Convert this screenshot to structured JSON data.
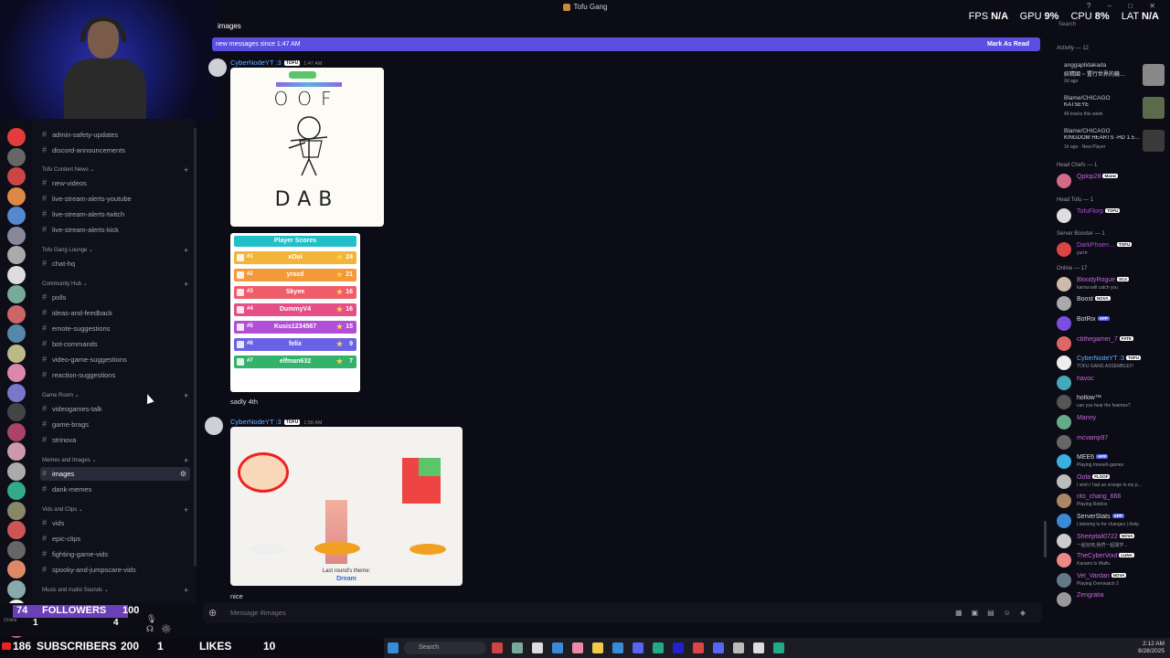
{
  "window": {
    "title": "Tofu Gang",
    "controls": [
      "?",
      "–",
      "□",
      "✕"
    ]
  },
  "overlay": {
    "fps_label": "FPS",
    "fps": "N/A",
    "gpu_label": "GPU",
    "gpu": "9%",
    "cpu_label": "CPU",
    "cpu": "8%",
    "lat_label": "LAT",
    "lat": "N/A"
  },
  "header": {
    "channel": "images",
    "search_placeholder": "Search"
  },
  "new_messages": {
    "text": "new messages since 1:47 AM",
    "mark_read": "Mark As Read"
  },
  "sidebar": {
    "categories": [
      {
        "label": "Tofu Content News ⌄",
        "channels": [
          "new-videos",
          "live-stream-alerts-youtube",
          "live-stream-alerts-twitch",
          "live-stream-alerts-kick"
        ]
      },
      {
        "label": "Tofu Gang Lounge ⌄",
        "channels": [
          "chat-hq"
        ]
      },
      {
        "label": "Community Hub ⌄",
        "channels": [
          "polls",
          "ideas-and-feedback",
          "emote-suggestions",
          "bot-commands",
          "video-game-suggestions",
          "reaction-suggestions"
        ]
      },
      {
        "label": "Game Room ⌄",
        "channels": [
          "videogames-talk",
          "game-brags",
          "strinova"
        ]
      },
      {
        "label": "Memes and Images ⌄",
        "channels": [
          "images",
          "dank-memes"
        ]
      },
      {
        "label": "Vids and Clips ⌄",
        "channels": [
          "vids",
          "epic-clips",
          "fighting-game-vids",
          "spooky-and-jumpscare-vids"
        ]
      },
      {
        "label": "Music and Audio Sounds ⌄",
        "channels": []
      }
    ],
    "top_channels": [
      "admin-safety-updates",
      "discord-announcements"
    ]
  },
  "stream": {
    "followers_count": "74",
    "followers_label": "FOLLOWERS",
    "followers_goal": "100",
    "sub_count": "186",
    "sub_label": "SUBSCRIBERS",
    "sub_goal": "200",
    "likes_count": "1",
    "likes_label": "LIKES",
    "likes_goal": "10",
    "user_status": "Online",
    "user_count_a": "1",
    "user_count_b": "4"
  },
  "messages": [
    {
      "author": "CyberNodeYT :3",
      "tag": "TOFU",
      "time": "1:47 AM",
      "drawing_words": [
        "OOF",
        "DAB"
      ],
      "scores_title": "Player Scores",
      "scores": [
        {
          "rank": "#1",
          "name": "xOui",
          "points": "24",
          "color": "#f2b53a"
        },
        {
          "rank": "#2",
          "name": "yraxd",
          "points": "21",
          "color": "#f29a3a"
        },
        {
          "rank": "#3",
          "name": "Skyee",
          "points": "16",
          "color": "#ef5d6a"
        },
        {
          "rank": "#4",
          "name": "DummyV4",
          "points": "16",
          "color": "#e64f86"
        },
        {
          "rank": "#5",
          "name": "Kusis1234567",
          "points": "15",
          "color": "#b04fd6"
        },
        {
          "rank": "#6",
          "name": "felix",
          "points": "9",
          "color": "#6a62e4"
        },
        {
          "rank": "#7",
          "name": "elfman632",
          "points": "7",
          "color": "#33b36a"
        }
      ],
      "text": "sadly 4th"
    },
    {
      "author": "CyberNodeYT :3",
      "tag": "TOFU",
      "time": "1:58 AM",
      "theme_label": "Last round's theme:",
      "theme": "Dream",
      "text": "nice"
    }
  ],
  "compose": {
    "placeholder": "Message #images"
  },
  "members": {
    "activity_head": "Activity — 12",
    "activities": [
      {
        "name": "anggaptidakada",
        "line": "妖精國 ~ 置行世界的鏡…",
        "sub": "2d ago",
        "color": "#888"
      },
      {
        "name": "Blame/CHICAGO",
        "line": "KATSEYE",
        "sub": "49 tracks this week",
        "color": "#5a6a4a"
      },
      {
        "name": "Blame/CHICAGO",
        "line": "KINGDOM HEARTS -HD 1.5…",
        "sub": "1h ago · New Player",
        "color": "#3a3a3a"
      }
    ],
    "groups": [
      {
        "head": "Head Chefs — 1",
        "items": [
          {
            "name": "Qplop28",
            "badge": "Maow",
            "sub": "",
            "color": "#c46ad6",
            "av": "#d46a8a"
          }
        ]
      },
      {
        "head": "Head Tofu — 1",
        "items": [
          {
            "name": "TofuFlorp",
            "badge": "TOFU",
            "sub": "",
            "color": "#b04fd6",
            "av": "#ddd"
          }
        ]
      },
      {
        "head": "Server Booster — 1",
        "items": [
          {
            "name": "DarkPhoen…",
            "badge": "TOFU",
            "sub": "yurrrr",
            "color": "#b04fd6",
            "av": "#d44"
          }
        ]
      },
      {
        "head": "Online — 17",
        "items": [
          {
            "name": "BloodyRogue",
            "badge": "SC4",
            "sub": "karma will catch you",
            "color": "#c46ad6",
            "av": "#cba"
          },
          {
            "name": "Boost",
            "badge": "NOVA",
            "sub": "",
            "color": "#ddd",
            "av": "#aaa"
          },
          {
            "name": "BotRix",
            "badge": "APP",
            "sub": "",
            "color": "#ddd",
            "av": "#7a4fe0"
          },
          {
            "name": "cbthegamer_7",
            "badge": "FATE",
            "sub": "",
            "color": "#c46ad6",
            "av": "#d66"
          },
          {
            "name": "CyberNodeYT :3",
            "badge": "TOFU",
            "sub": "TOFU GANG ASSEMBLE!!!",
            "color": "#5fb0ff",
            "av": "#eee"
          },
          {
            "name": "havoc",
            "badge": "",
            "sub": "",
            "color": "#c46ad6",
            "av": "#4ab"
          },
          {
            "name": "hollow™",
            "badge": "",
            "sub": "can you hear the fwames?",
            "color": "#ddd",
            "av": "#555"
          },
          {
            "name": "Manny",
            "badge": "",
            "sub": "",
            "color": "#c46ad6",
            "av": "#6a8"
          },
          {
            "name": "mcvamp97",
            "badge": "",
            "sub": "",
            "color": "#c46ad6",
            "av": "#666"
          },
          {
            "name": "MEE6",
            "badge": "APP",
            "sub": "Playing /meee6-games",
            "color": "#ddd",
            "av": "#3ab0e0"
          },
          {
            "name": "Oofa",
            "badge": "FLOOF",
            "sub": "I wish I had an orange in my p…",
            "color": "#c46ad6",
            "av": "#bbb"
          },
          {
            "name": "rito_chang_666",
            "badge": "",
            "sub": "Playing Roblox",
            "color": "#c46ad6",
            "av": "#a86"
          },
          {
            "name": "ServerStats",
            "badge": "APP",
            "sub": "Listening to for changes | /help",
            "color": "#ddd",
            "av": "#3a8ad6"
          },
          {
            "name": "Sheepfall0722",
            "badge": "NOVA",
            "sub": "一起玩吧,我們一起開学…",
            "color": "#c46ad6",
            "av": "#ccc"
          },
          {
            "name": "TheCyberVoid",
            "badge": "LUNA",
            "sub": "Kanami Is Waifu",
            "color": "#c46ad6",
            "av": "#e88"
          },
          {
            "name": "Vel_Vardan",
            "badge": "NOVA",
            "sub": "Playing Overwatch 2",
            "color": "#c46ad6",
            "av": "#678"
          },
          {
            "name": "Zengratia",
            "badge": "",
            "sub": "",
            "color": "#c46ad6",
            "av": "#999"
          }
        ]
      }
    ]
  },
  "taskbar": {
    "search": "Search",
    "time": "2:12 AM",
    "date": "8/28/2025"
  }
}
